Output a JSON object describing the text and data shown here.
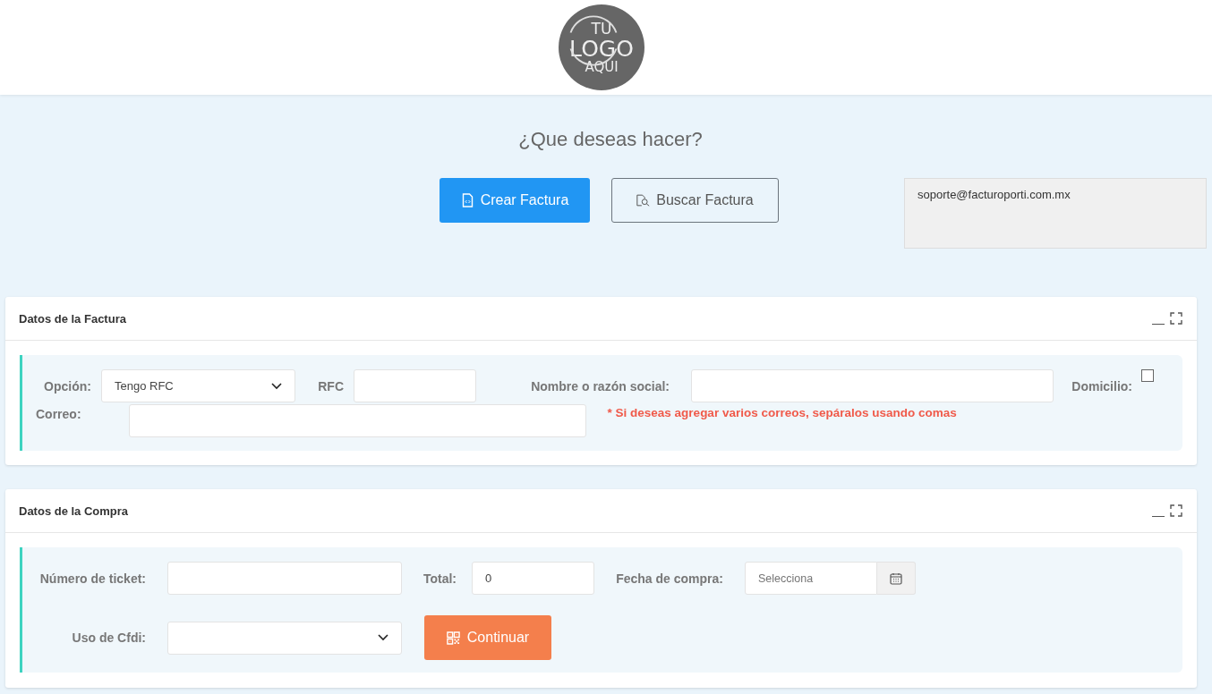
{
  "logo": {
    "lines": [
      "TU",
      "LOGO",
      "AQUI"
    ]
  },
  "heading": "¿Que deseas hacer?",
  "actions": [
    {
      "label": "Crear Factura",
      "kind": "primary"
    },
    {
      "label": "Buscar Factura",
      "kind": "outline"
    }
  ],
  "support": {
    "email": "soporte@facturoporti.com.mx"
  },
  "invoice_panel": {
    "title": "Datos de la Factura",
    "option": {
      "label": "Opción:",
      "value": "Tengo RFC"
    },
    "rfc": {
      "label": "RFC"
    },
    "name": {
      "label": "Nombre o razón social:"
    },
    "address": {
      "label": "Domicilio:",
      "checked": false
    },
    "email": {
      "label": "Correo:"
    },
    "note": "* Si deseas agregar varios correos, sepáralos usando comas"
  },
  "purchase_panel": {
    "title": "Datos de la Compra",
    "ticket": {
      "label": "Número de ticket:"
    },
    "total": {
      "label": "Total:",
      "value": "0"
    },
    "date": {
      "label": "Fecha de compra:",
      "placeholder": "Selecciona"
    },
    "cfdi": {
      "label": "Uso de Cfdi:"
    },
    "continue_button": "Continuar"
  }
}
